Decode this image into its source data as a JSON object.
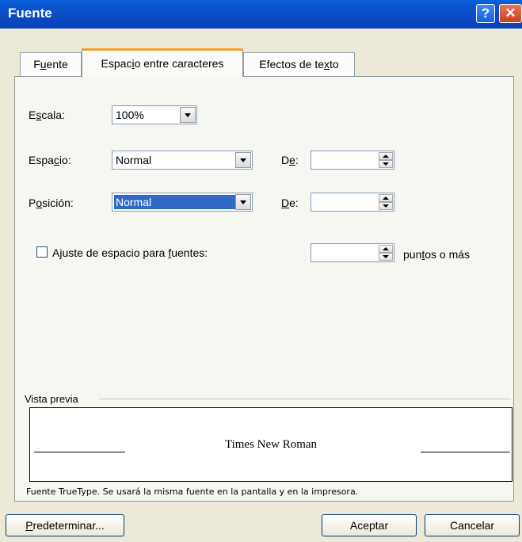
{
  "window": {
    "title": "Fuente",
    "help_glyph": "?",
    "close_glyph": "✕"
  },
  "tabs": [
    {
      "label_pre": "F",
      "label_key": "u",
      "label_post": "ente",
      "active": false
    },
    {
      "label_pre": "Espac",
      "label_key": "i",
      "label_post": "o entre caracteres",
      "active": true
    },
    {
      "label_pre": "Efectos de te",
      "label_key": "x",
      "label_post": "to",
      "active": false
    }
  ],
  "escala": {
    "label_pre": "E",
    "label_key": "s",
    "label_post": "cala:",
    "value": "100%"
  },
  "espacio": {
    "label_pre": "Espa",
    "label_key": "c",
    "label_post": "io:",
    "value": "Normal",
    "de_pre": "D",
    "de_key": "e",
    "de_post": ":",
    "de_value": ""
  },
  "posicion": {
    "label_pre": "P",
    "label_key": "o",
    "label_post": "sición:",
    "value": "Normal",
    "de_pre": "",
    "de_key": "D",
    "de_post": "e:",
    "de_value": ""
  },
  "kerning": {
    "label_pre": "Ajuste de espacio para ",
    "label_key": "f",
    "label_post": "uentes:",
    "checked": false,
    "value": "",
    "suffix_pre": "pun",
    "suffix_key": "t",
    "suffix_post": "os o más"
  },
  "preview": {
    "label": "Vista previa",
    "sample": "Times New Roman",
    "note": "Fuente TrueType. Se usará la misma fuente en la pantalla y en la impresora."
  },
  "buttons": {
    "predeterminar_key": "P",
    "predeterminar_rest": "redeterminar...",
    "aceptar": "Aceptar",
    "cancelar": "Cancelar"
  },
  "colors": {
    "title_bar": "#0a4fc8",
    "selection": "#316ac5",
    "tab_highlight": "#f2a336",
    "dialog_bg": "#ece9d8"
  }
}
